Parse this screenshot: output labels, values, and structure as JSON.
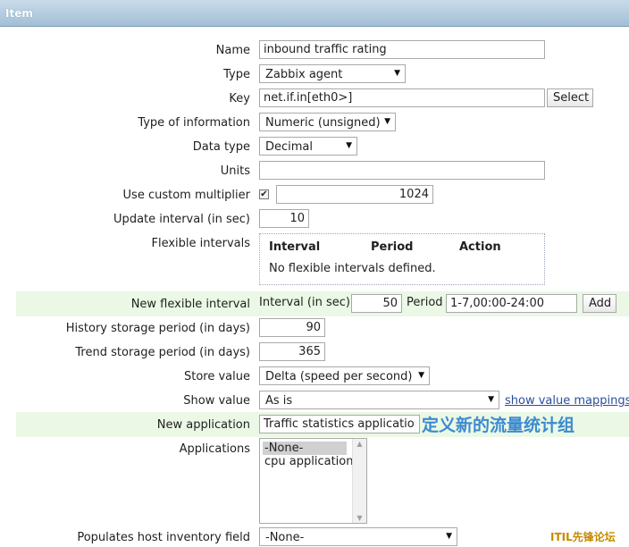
{
  "header": {
    "title": "Item"
  },
  "form": {
    "name": {
      "label": "Name",
      "value": "inbound traffic rating"
    },
    "type": {
      "label": "Type",
      "value": "Zabbix agent"
    },
    "key": {
      "label": "Key",
      "value": "net.if.in[eth0>]",
      "button": "Select"
    },
    "type_of_information": {
      "label": "Type of information",
      "value": "Numeric (unsigned)"
    },
    "data_type": {
      "label": "Data type",
      "value": "Decimal"
    },
    "units": {
      "label": "Units",
      "value": ""
    },
    "custom_multiplier": {
      "label": "Use custom multiplier",
      "checked": true,
      "value": "1024"
    },
    "update_interval": {
      "label": "Update interval (in sec)",
      "value": "10"
    },
    "flexible_intervals": {
      "label": "Flexible intervals",
      "columns": [
        "Interval",
        "Period",
        "Action"
      ],
      "empty_text": "No flexible intervals defined."
    },
    "new_flexible_interval": {
      "label": "New flexible interval",
      "interval_label": "Interval (in sec)",
      "interval_value": "50",
      "period_label": "Period",
      "period_value": "1-7,00:00-24:00",
      "add_button": "Add"
    },
    "history": {
      "label": "History storage period (in days)",
      "value": "90"
    },
    "trends": {
      "label": "Trend storage period (in days)",
      "value": "365"
    },
    "store_value": {
      "label": "Store value",
      "value": "Delta (speed per second)"
    },
    "show_value": {
      "label": "Show value",
      "value": "As is",
      "link": "show value mappings"
    },
    "new_application": {
      "label": "New application",
      "value": "Traffic statistics application",
      "annotation": "定义新的流量统计组"
    },
    "applications": {
      "label": "Applications",
      "options": [
        "-None-",
        "cpu application"
      ]
    },
    "inventory_field": {
      "label": "Populates host inventory field",
      "value": "-None-"
    }
  },
  "watermark": "ITIL先锋论坛",
  "colors": {
    "header": "#a2bfd6",
    "band": "#eaf8e5",
    "link": "#2a4e9c",
    "annotation": "#3c8ad1"
  }
}
